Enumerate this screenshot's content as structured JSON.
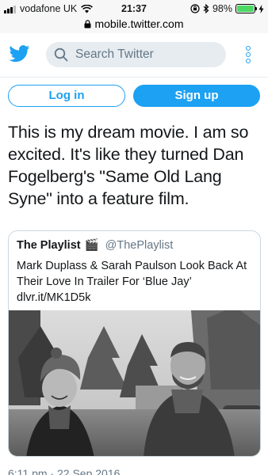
{
  "status_bar": {
    "carrier": "vodafone UK",
    "time": "21:37",
    "battery": "98%",
    "battery_level": 0.98
  },
  "url_bar": {
    "url": "mobile.twitter.com"
  },
  "header": {
    "search_placeholder": "Search Twitter",
    "brand_color": "#1da1f2"
  },
  "auth": {
    "login_label": "Log in",
    "signup_label": "Sign up"
  },
  "tweet": {
    "text": "This is my dream movie. I am so excited. It's like they turned Dan Fogelberg's \"Same Old Lang Syne\" into a feature film.",
    "timestamp": "6:11 pm · 22 Sep 2016"
  },
  "quoted_tweet": {
    "name": "The Playlist",
    "name_emoji": "🎬",
    "handle": "@ThePlaylist",
    "text": "Mark Duplass & Sarah Paulson Look Back At Their Love In Trailer For ‘Blue Jay’",
    "link": "dlvr.it/MK1D5k"
  }
}
